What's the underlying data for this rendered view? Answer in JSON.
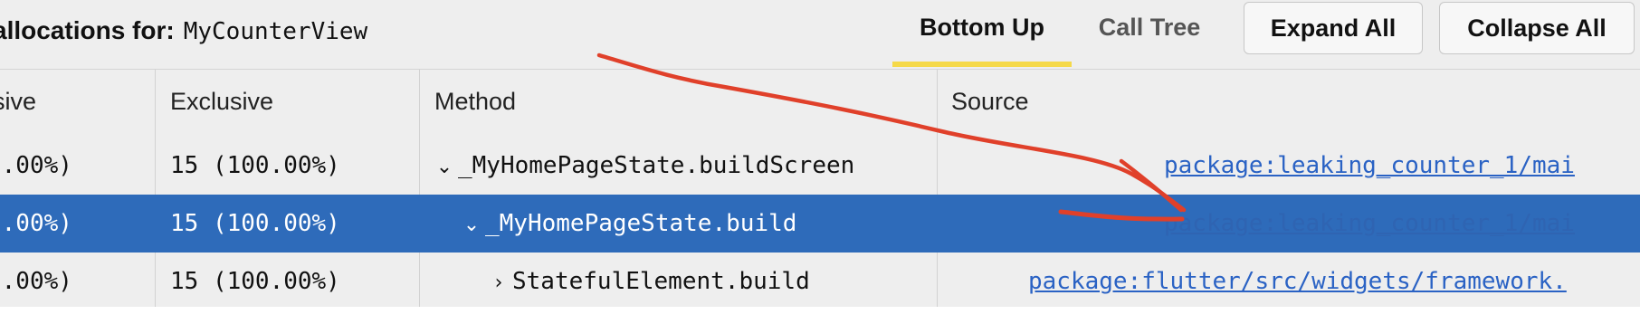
{
  "header": {
    "title_label": "allocations for:",
    "class_name": "MyCounterView",
    "tabs": [
      {
        "label": "Bottom Up",
        "selected": true
      },
      {
        "label": "Call Tree",
        "selected": false
      }
    ],
    "buttons": {
      "expand_all": "Expand All",
      "collapse_all": "Collapse All"
    },
    "accent_color": "#f5d949"
  },
  "table": {
    "columns": [
      "sive",
      "Exclusive",
      "Method",
      "Source"
    ],
    "rows": [
      {
        "inclusive": "0.00%)",
        "exclusive": "15 (100.00%)",
        "expander": "expanded",
        "method": "_MyHomePageState.buildScreen",
        "source": "package:leaking_counter_1/mai",
        "selected": false
      },
      {
        "inclusive": "0.00%)",
        "exclusive": "15 (100.00%)",
        "expander": "expanded",
        "method": "_MyHomePageState.build",
        "source": "package:leaking_counter_1/mai",
        "selected": true
      },
      {
        "inclusive": "0.00%)",
        "exclusive": "15 (100.00%)",
        "expander": "collapsed",
        "method": "StatefulElement.build",
        "source": "package:flutter/src/widgets/framework.",
        "selected": false
      }
    ],
    "selected_row_color": "#2e6bba",
    "link_color": "#2a62c4"
  },
  "annotation": {
    "stroke_color": "#e0402a"
  }
}
